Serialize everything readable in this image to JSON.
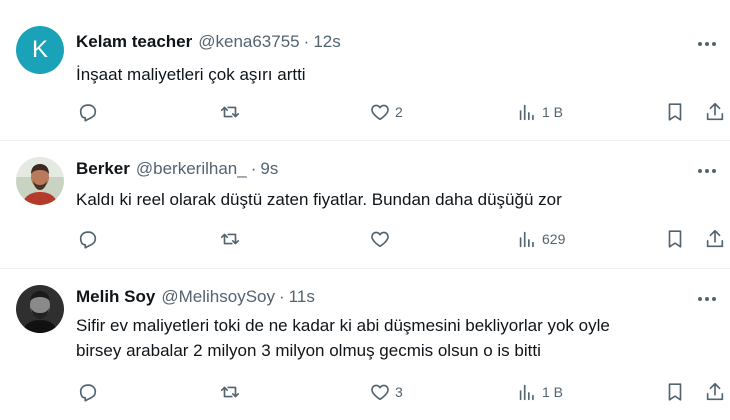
{
  "tweets": [
    {
      "avatar_letter": "K",
      "name": "Kelam teacher",
      "handle": "@kena63755",
      "separator": "·",
      "time": "12s",
      "text": "İnşaat maliyetleri çok aşırı artti",
      "likes": "2",
      "views": "1 B"
    },
    {
      "name": "Berker",
      "handle": "@berkerilhan_",
      "separator": "·",
      "time": "9s",
      "text": "Kaldı ki reel olarak düştü zaten fiyatlar. Bundan daha düşüğü zor",
      "likes": "",
      "views": "629"
    },
    {
      "name": "Melih Soy",
      "handle": "@MelihsoySoy",
      "separator": "·",
      "time": "11s",
      "text_line1": "Sifir ev maliyetleri toki de ne kadar ki abi düşmesini bekliyorlar yok oyle",
      "text_line2": "birsey arabalar 2 milyon 3 milyon olmuş gecmis olsun o is bitti",
      "likes": "3",
      "views": "1 B"
    }
  ],
  "colors": {
    "text": "#0f1419",
    "secondary": "#536471",
    "divider": "#eff3f4",
    "avatar_k": "#1aa3b8"
  },
  "icons": [
    "reply-icon",
    "retweet-icon",
    "like-icon",
    "views-icon",
    "bookmark-icon",
    "share-icon",
    "more-icon"
  ]
}
